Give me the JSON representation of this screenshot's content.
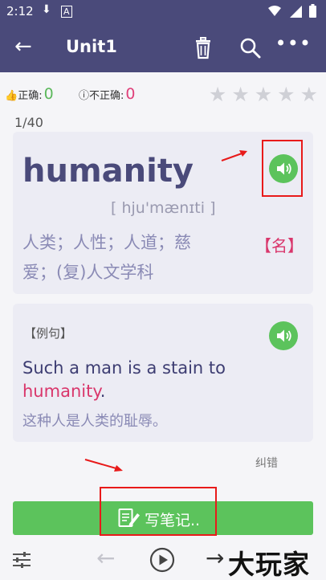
{
  "status_bar": {
    "time": "2:12"
  },
  "app_bar": {
    "title": "Unit1"
  },
  "stats": {
    "correct_label": "正确:",
    "correct_count": "0",
    "incorrect_label": "不正确:",
    "incorrect_count": "0",
    "stars_filled": 0,
    "stars_total": 5
  },
  "progress": "1/40",
  "word_card": {
    "word": "humanity",
    "phonetic": "[ hju'mænɪti ]",
    "definition_line1": "人类；人性；人道；慈",
    "definition_line2": "爱；(复)人文学科",
    "part_of_speech": "【名】"
  },
  "example": {
    "label": "【例句】",
    "sentence_before": "Such a man is a stain to",
    "sentence_word": "humanity",
    "sentence_after": ".",
    "translation": "这种人是人类的耻辱。"
  },
  "report_error": "纠错",
  "note_button": "写笔记..",
  "watermark": "大玩家",
  "colors": {
    "primary": "#4a4a7a",
    "accent_green": "#5cc35c",
    "highlight_pink": "#d9366b",
    "annotation_red": "#e81a1a"
  }
}
